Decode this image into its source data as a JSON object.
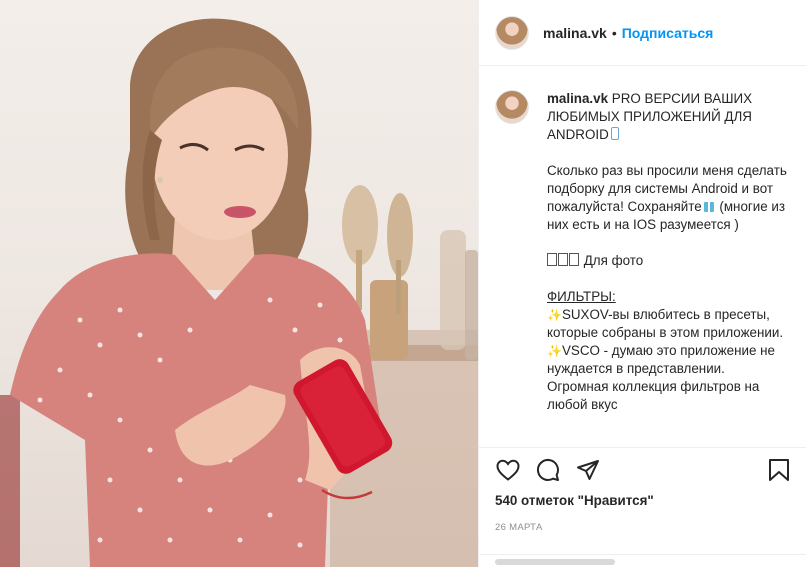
{
  "post": {
    "username": "malina.vk",
    "separator": "•",
    "follow_label": "Подписаться",
    "photo_alt": "photo"
  },
  "caption": {
    "username": "malina.vk",
    "title": "PRO ВЕРСИИ ВАШИХ ЛЮБИМЫХ ПРИЛОЖЕНИЙ ДЛЯ ANDROID",
    "para1_line1": "Сколько раз вы просили меня сделать подборку для системы Android и вот пожалуйста!",
    "para1_save": "Сохраняйте",
    "para1_tail": "(многие из них есть и на IOS разумеется )",
    "photo_line": "Для фото",
    "filters_heading": "ФИЛЬТРЫ:",
    "item1": "SUXOV-вы влюбитесь в пресеты, которые собраны в этом приложении.",
    "item2": "VSCO - думаю это приложение не нуждается в представлении. Огромная коллекция фильтров на любой вкус"
  },
  "actions": {
    "likes_text": "540 отметок \"Нравится\"",
    "date_text": "26 марта",
    "icons": [
      "heart-icon",
      "comment-icon",
      "share-icon",
      "bookmark-icon"
    ]
  },
  "colors": {
    "accent": "#0095f6",
    "text": "#262626",
    "muted": "#8e8e8e"
  }
}
